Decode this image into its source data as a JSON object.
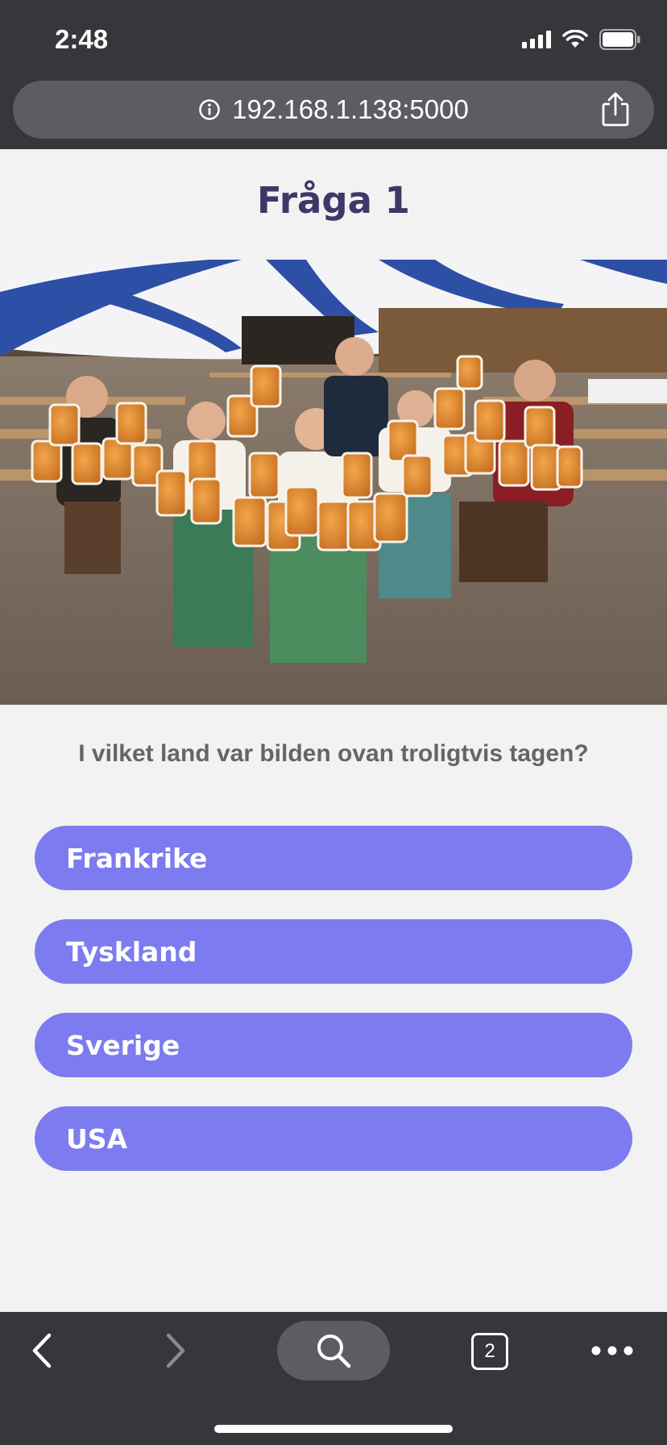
{
  "status_bar": {
    "time": "2:48",
    "icons": [
      "cellular-signal-icon",
      "wifi-icon",
      "battery-icon"
    ]
  },
  "browser": {
    "url": "192.168.1.138:5000",
    "info_icon": "info-icon",
    "share_icon": "share-icon"
  },
  "quiz": {
    "title": "Fråga 1",
    "image_description_alt": "Personer i folkdräkt som bär många ölsejdlar i ett stort festtält",
    "question": "I vilket land var bilden ovan troligtvis tagen?",
    "answers": [
      {
        "label": "Frankrike"
      },
      {
        "label": "Tyskland"
      },
      {
        "label": "Sverige"
      },
      {
        "label": "USA"
      }
    ]
  },
  "toolbar": {
    "tab_count": "2",
    "icons": [
      "back-icon",
      "forward-icon",
      "search-icon",
      "tabs-icon",
      "more-icon"
    ]
  },
  "colors": {
    "chrome": "#36373a",
    "pill": "#5c5d61",
    "page_background": "#f2f2f2",
    "title": "#3e3868",
    "question": "#656565",
    "answer_button": "#7c7cf0"
  }
}
